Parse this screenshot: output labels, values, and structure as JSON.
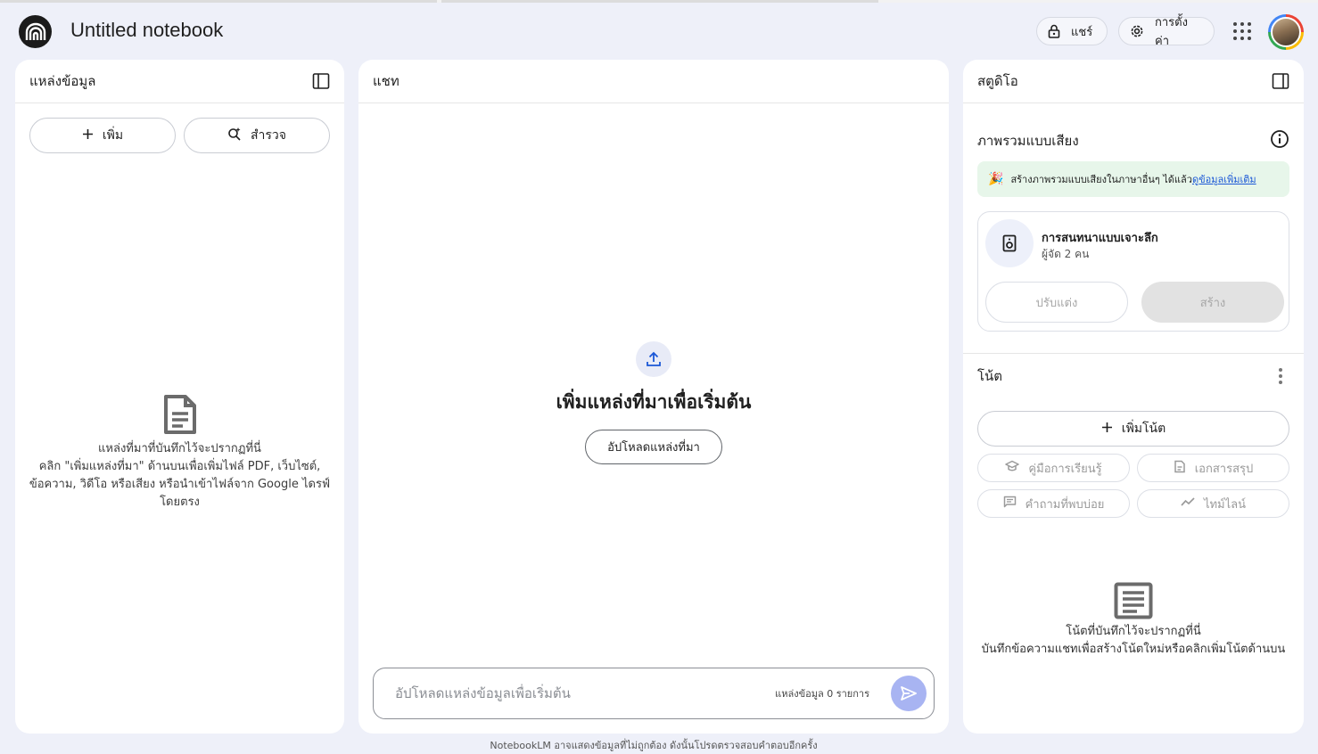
{
  "header": {
    "title": "Untitled notebook",
    "share_label": "แชร์",
    "settings_label": "การตั้งค่า"
  },
  "sources": {
    "title": "แหล่งข้อมูล",
    "add_label": "เพิ่ม",
    "explore_label": "สำรวจ",
    "empty_title": "แหล่งที่มาที่บันทึกไว้จะปรากฏที่นี่",
    "empty_desc": "คลิก \"เพิ่มแหล่งที่มา\" ด้านบนเพื่อเพิ่มไฟล์ PDF, เว็บไซต์, ข้อความ, วิดีโอ หรือเสียง หรือนำเข้าไฟล์จาก Google ไดรฟ์โดยตรง"
  },
  "chat": {
    "title": "แชท",
    "heading": "เพิ่มแหล่งที่มาเพื่อเริ่มต้น",
    "upload_label": "อัปโหลดแหล่งที่มา",
    "input_placeholder": "อัปโหลดแหล่งข้อมูลเพื่อเริ่มต้น",
    "source_count": "แหล่งข้อมูล 0 รายการ",
    "footer": "NotebookLM อาจแสดงข้อมูลที่ไม่ถูกต้อง ดังนั้นโปรดตรวจสอบคำตอบอีกครั้ง"
  },
  "studio": {
    "title": "สตูดิโอ",
    "audio_title": "ภาพรวมแบบเสียง",
    "banner_text": "สร้างภาพรวมแบบเสียงในภาษาอื่นๆ ได้แล้ว",
    "banner_link": "ดูข้อมูลเพิ่มเติม",
    "card_title": "การสนทนาแบบเจาะลึก",
    "card_subtitle": "ผู้จัด 2 คน",
    "customize_label": "ปรับแต่ง",
    "create_label": "สร้าง",
    "notes_title": "โน้ต",
    "add_note_label": "เพิ่มโน้ต",
    "chips": [
      "คู่มือการเรียนรู้",
      "เอกสารสรุป",
      "คำถามที่พบบ่อย",
      "ไทม์ไลน์"
    ],
    "notes_empty_title": "โน้ตที่บันทึกไว้จะปรากฏที่นี่",
    "notes_empty_desc": "บันทึกข้อความแชทเพื่อสร้างโน้ตใหม่หรือคลิกเพิ่มโน้ตด้านบน"
  },
  "colors": {
    "background": "#eef0f9",
    "send_button": "#a8b4f2",
    "banner_bg": "#e7f6ea",
    "link": "#1a57d6"
  }
}
